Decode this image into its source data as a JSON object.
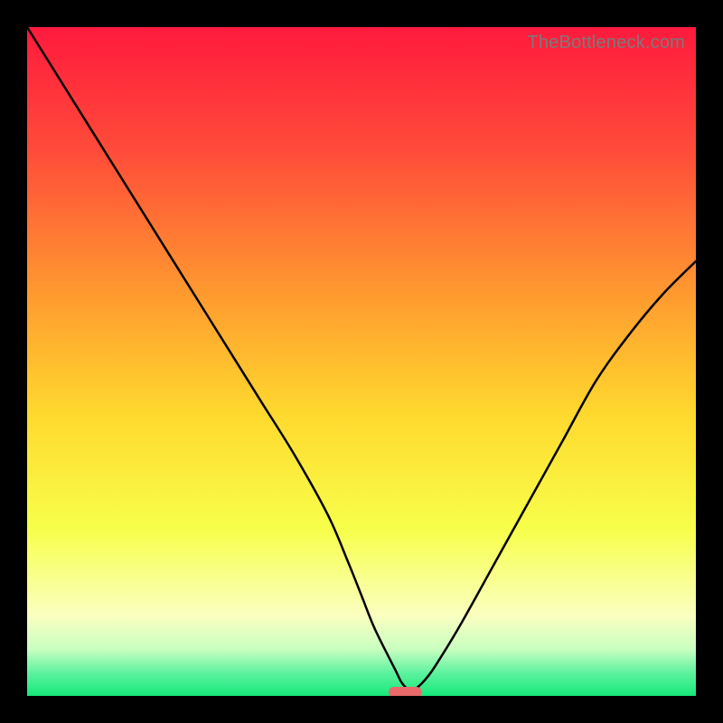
{
  "watermark": "TheBottleneck.com",
  "chart_data": {
    "type": "line",
    "title": "",
    "xlabel": "",
    "ylabel": "",
    "xlim": [
      0,
      100
    ],
    "ylim": [
      0,
      100
    ],
    "grid": false,
    "legend": false,
    "series": [
      {
        "name": "bottleneck-curve",
        "color": "#000000",
        "x": [
          0,
          5,
          10,
          15,
          20,
          25,
          30,
          35,
          40,
          45,
          48,
          50,
          52,
          55,
          56,
          57,
          58,
          60,
          62,
          65,
          70,
          75,
          80,
          85,
          90,
          95,
          100
        ],
        "y": [
          100,
          92,
          84,
          76,
          68,
          60,
          52,
          44,
          36,
          27,
          20,
          15,
          10,
          4,
          2,
          1,
          1,
          3,
          6,
          11,
          20,
          29,
          38,
          47,
          54,
          60,
          65
        ]
      }
    ],
    "background_gradient": {
      "stops": [
        {
          "offset": 0.0,
          "color": "#ff1a3d"
        },
        {
          "offset": 0.18,
          "color": "#ff4a3a"
        },
        {
          "offset": 0.4,
          "color": "#ff9a2f"
        },
        {
          "offset": 0.58,
          "color": "#ffd92e"
        },
        {
          "offset": 0.75,
          "color": "#f7ff4a"
        },
        {
          "offset": 0.88,
          "color": "#faffc0"
        },
        {
          "offset": 0.93,
          "color": "#c9ffc0"
        },
        {
          "offset": 0.965,
          "color": "#5ff2a0"
        },
        {
          "offset": 1.0,
          "color": "#17e87a"
        }
      ]
    },
    "marker": {
      "x_center": 56.5,
      "y": 0.6,
      "width_pct": 5.0,
      "color": "#e86a6a"
    }
  }
}
